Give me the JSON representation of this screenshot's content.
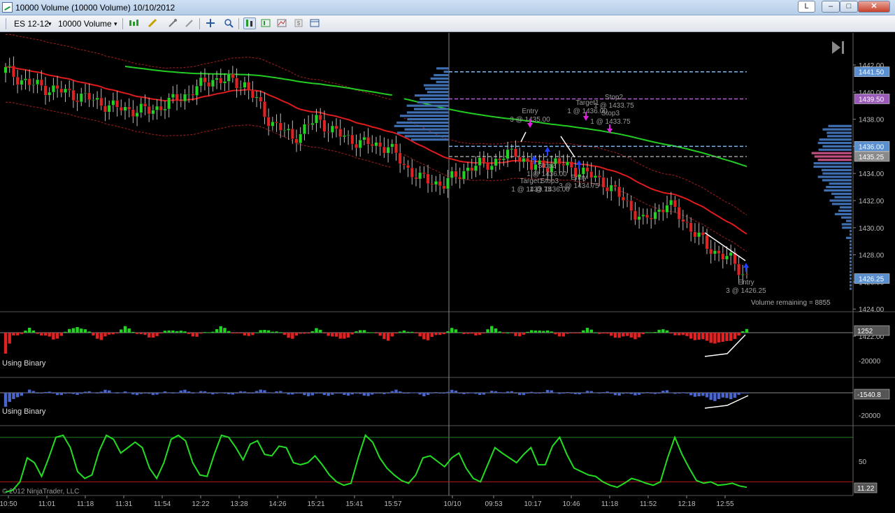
{
  "window": {
    "title": "10000 Volume (10000 Volume)  10/10/2012",
    "btn_l": "L",
    "btn_min": "–",
    "btn_max": "□",
    "btn_close": "✕"
  },
  "toolbar": {
    "instrument": "ES 12-12",
    "period": "10000 Volume",
    "dropdown_glyph": "▾"
  },
  "colors": {
    "background": "#000000",
    "up_candle": "#22d422",
    "down_candle": "#e02222",
    "ema_fast": "#e01b1b",
    "ema_slow": "#22cc22",
    "band": "#8a1a1a",
    "profile": "#3f6fb0",
    "cyan_level": "#7fb8e8",
    "magenta_level": "#b060c8",
    "osc_line": "#22dd22",
    "hist_blue": "#4a66cc"
  },
  "chart_data": [
    {
      "type": "candlestick",
      "panel": "price",
      "x_tick_labels": [
        "10:50",
        "11:01",
        "11:18",
        "11:31",
        "11:54",
        "12:22",
        "13:28",
        "14:26",
        "15:21",
        "15:41",
        "15:57",
        "10/10",
        "09:53",
        "10:17",
        "10:46",
        "11:18",
        "11:52",
        "12:18",
        "12:55"
      ],
      "y_tick_labels": [
        "1442.00",
        "1440.00",
        "1438.00",
        "1436.00",
        "1434.00",
        "1432.00",
        "1430.00",
        "1428.00",
        "1426.00",
        "1424.00",
        "1422.00"
      ],
      "ylim": [
        1421.5,
        1443
      ],
      "price_tags": [
        {
          "label": "1441.50",
          "value": 1441.5,
          "color": "#5a8fd0"
        },
        {
          "label": "1439.50",
          "value": 1439.5,
          "color": "#9a5ab8"
        },
        {
          "label": "1436.00",
          "value": 1436.0,
          "color": "#5a8fd0"
        },
        {
          "label": "1435.25",
          "value": 1435.25,
          "color": "#8a8a8a"
        },
        {
          "label": "1426.25",
          "value": 1426.25,
          "color": "#5a8fd0"
        }
      ],
      "levels": [
        {
          "value": 1441.5,
          "color": "#7fb8e8"
        },
        {
          "value": 1439.5,
          "color": "#b060c8"
        },
        {
          "value": 1436.0,
          "color": "#7fb8e8"
        },
        {
          "value": 1435.25,
          "color": "#9a9a9a"
        }
      ],
      "close_keypoints": [
        [
          0,
          1441.6
        ],
        [
          6,
          1440.6
        ],
        [
          12,
          1440.2
        ],
        [
          20,
          1439.6
        ],
        [
          28,
          1438.8
        ],
        [
          36,
          1438.6
        ],
        [
          44,
          1439.6
        ],
        [
          52,
          1441.0
        ],
        [
          60,
          1440.6
        ],
        [
          66,
          1438.0
        ],
        [
          72,
          1436.6
        ],
        [
          78,
          1438.0
        ],
        [
          84,
          1436.8
        ],
        [
          90,
          1436.2
        ],
        [
          96,
          1436.0
        ],
        [
          100,
          1434.6
        ],
        [
          104,
          1433.6
        ],
        [
          110,
          1433.2
        ],
        [
          116,
          1434.4
        ],
        [
          122,
          1434.8
        ],
        [
          128,
          1435.6
        ],
        [
          132,
          1434.4
        ],
        [
          138,
          1434.8
        ],
        [
          144,
          1434.2
        ],
        [
          150,
          1433.4
        ],
        [
          156,
          1431.8
        ],
        [
          160,
          1430.4
        ],
        [
          166,
          1431.8
        ],
        [
          170,
          1430.6
        ],
        [
          176,
          1428.6
        ],
        [
          182,
          1427.6
        ],
        [
          186,
          1426.4
        ]
      ],
      "annotations": [
        {
          "text": "Entry",
          "sub": "3 @ 1435.00",
          "color": "#9a9a9a"
        },
        {
          "text": "Target1",
          "sub": "1 @ 1436.00",
          "color": "#9a9a9a"
        },
        {
          "text": "Stop2",
          "sub": "1 @ 1433.75",
          "color": "#9a9a9a"
        },
        {
          "text": "Stop3",
          "sub": "1 @ 1433.75",
          "color": "#9a9a9a"
        },
        {
          "text": "Stop2",
          "sub": "1 @ 1436.00",
          "color": "#9a9a9a"
        },
        {
          "text": "Target1",
          "sub": "1 @ 1433.75",
          "color": "#9a9a9a"
        },
        {
          "text": "Stop3",
          "sub": "1 @ 1436.00",
          "color": "#9a9a9a"
        },
        {
          "text": "Entry",
          "sub": "3 @ 1434.75",
          "color": "#9a9a9a"
        },
        {
          "text": "Entry",
          "sub": "3 @ 1426.25",
          "color": "#9a9a9a"
        }
      ],
      "volume_remaining": "Volume remaining = 8855",
      "copyright": "© 2012 NinjaTrader, LLC"
    },
    {
      "type": "bar",
      "panel": "delta",
      "label": "Using Binary",
      "value_tag": "1252",
      "y_tick_labels": [
        "-20000"
      ],
      "bar_keypoints": [
        [
          0,
          -6
        ],
        [
          2,
          -1
        ],
        [
          6,
          1
        ],
        [
          12,
          -2
        ],
        [
          18,
          2
        ],
        [
          24,
          -2
        ],
        [
          30,
          1.5
        ],
        [
          36,
          -1.5
        ],
        [
          42,
          1
        ],
        [
          48,
          -1
        ],
        [
          54,
          1.5
        ],
        [
          60,
          -1
        ],
        [
          66,
          1
        ],
        [
          72,
          -1.5
        ],
        [
          78,
          1
        ],
        [
          84,
          -2
        ],
        [
          90,
          1
        ],
        [
          96,
          -2
        ],
        [
          100,
          1
        ],
        [
          106,
          -2
        ],
        [
          112,
          1
        ],
        [
          118,
          -1
        ],
        [
          122,
          1.5
        ],
        [
          128,
          -1
        ],
        [
          134,
          1
        ],
        [
          140,
          -1
        ],
        [
          146,
          1
        ],
        [
          152,
          -1
        ],
        [
          158,
          -1.5
        ],
        [
          164,
          1
        ],
        [
          170,
          -1
        ],
        [
          176,
          -2.5
        ],
        [
          180,
          -3
        ],
        [
          184,
          -1
        ],
        [
          186,
          1
        ]
      ]
    },
    {
      "type": "bar",
      "panel": "cumulative",
      "label": "Using Binary",
      "value_tag": "-1540.8",
      "y_tick_labels": [
        "-20000"
      ],
      "bar_keypoints": [
        [
          0,
          -4
        ],
        [
          3,
          -1
        ],
        [
          6,
          0.5
        ],
        [
          15,
          -0.5
        ],
        [
          25,
          0.5
        ],
        [
          35,
          -0.5
        ],
        [
          45,
          0.5
        ],
        [
          55,
          -0.3
        ],
        [
          65,
          0.6
        ],
        [
          75,
          -0.6
        ],
        [
          85,
          -0.4
        ],
        [
          92,
          -0.6
        ],
        [
          98,
          0.5
        ],
        [
          105,
          -0.6
        ],
        [
          112,
          0.5
        ],
        [
          118,
          -0.5
        ],
        [
          124,
          0.5
        ],
        [
          130,
          -0.4
        ],
        [
          136,
          0.5
        ],
        [
          142,
          -0.3
        ],
        [
          148,
          0.4
        ],
        [
          154,
          -0.5
        ],
        [
          160,
          -0.3
        ],
        [
          166,
          0.4
        ],
        [
          172,
          -0.5
        ],
        [
          178,
          -2
        ],
        [
          182,
          -1.5
        ],
        [
          186,
          0
        ]
      ]
    },
    {
      "type": "line",
      "panel": "oscillator",
      "value_tag": "11.22",
      "y_tick_labels": [
        "50"
      ],
      "ylim": [
        0,
        100
      ],
      "series": [
        {
          "values": [
            5,
            8,
            20,
            55,
            48,
            28,
            55,
            85,
            88,
            70,
            35,
            25,
            30,
            65,
            88,
            82,
            62,
            70,
            78,
            70,
            40,
            25,
            48,
            82,
            88,
            80,
            48,
            30,
            28,
            60,
            88,
            85,
            70,
            52,
            75,
            80,
            60,
            58,
            72,
            70,
            48,
            45,
            48,
            58,
            45,
            30,
            20,
            15,
            18,
            55,
            88,
            78,
            55,
            40,
            30,
            22,
            18,
            30,
            55,
            58,
            50,
            42,
            55,
            62,
            40,
            25,
            20,
            45,
            70,
            62,
            55,
            48,
            60,
            70,
            45,
            45,
            72,
            85,
            60,
            40,
            35,
            30,
            28,
            20,
            15,
            12,
            18,
            25,
            22,
            18,
            15,
            20,
            55,
            85,
            60,
            40,
            22,
            18,
            20,
            15,
            16,
            18,
            14,
            12
          ]
        }
      ]
    }
  ]
}
